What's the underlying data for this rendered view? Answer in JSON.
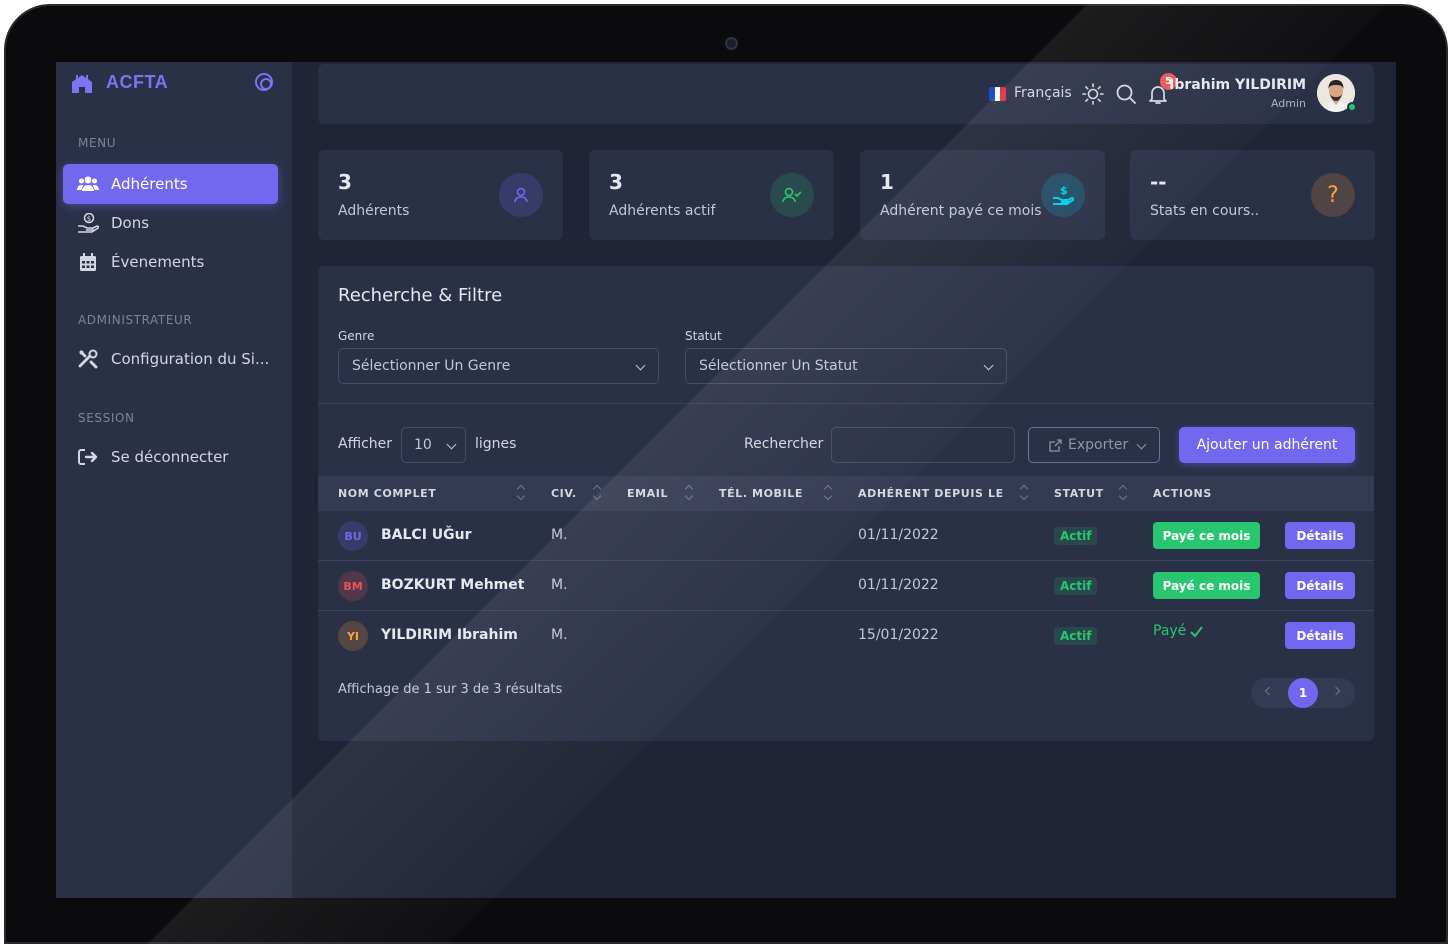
{
  "brand": {
    "name": "ACFTA"
  },
  "sidebar": {
    "sections": [
      {
        "label": "MENU"
      },
      {
        "label": "ADMINISTRATEUR"
      },
      {
        "label": "SESSION"
      }
    ],
    "items": [
      {
        "label": "Adhérents",
        "icon": "users-icon",
        "active": true
      },
      {
        "label": "Dons",
        "icon": "donation-icon"
      },
      {
        "label": "Évenements",
        "icon": "calendar-icon"
      },
      {
        "label": "Configuration du Si...",
        "icon": "tools-icon"
      },
      {
        "label": "Se déconnecter",
        "icon": "logout-icon"
      }
    ]
  },
  "topbar": {
    "language": "Français",
    "notifications_count": "5",
    "user_name": "Ibrahim YILDIRIM",
    "user_role": "Admin"
  },
  "stats": [
    {
      "value": "3",
      "label": "Adhérents",
      "icon": "user-icon",
      "color": "#7367f0"
    },
    {
      "value": "3",
      "label": "Adhérents actif",
      "icon": "user-check-icon",
      "color": "#28c76f"
    },
    {
      "value": "1",
      "label": "Adhérent payé ce mois",
      "icon": "hand-coin-icon",
      "color": "#00cfe8"
    },
    {
      "value": "--",
      "label": "Stats en cours..",
      "icon": "question-icon",
      "color": "#ff9f43"
    }
  ],
  "filter": {
    "title": "Recherche & Filtre",
    "genre_label": "Genre",
    "genre_value": "Sélectionner Un Genre",
    "statut_label": "Statut",
    "statut_value": "Sélectionner Un Statut"
  },
  "controls": {
    "show_label": "Afficher",
    "page_length": "10",
    "rows_label": "lignes",
    "search_label": "Rechercher",
    "export_label": "Exporter",
    "add_label": "Ajouter un adhérent"
  },
  "table": {
    "headers": [
      "NOM COMPLET",
      "CIV.",
      "EMAIL",
      "TÉL. MOBILE",
      "ADHÉRENT DEPUIS LE",
      "STATUT",
      "ACTIONS"
    ],
    "rows": [
      {
        "initials": "BU",
        "name": "BALCI UĞur",
        "civ": "M.",
        "email": "",
        "phone": "",
        "since": "01/11/2022",
        "status": "Actif",
        "pay": "Payé ce mois",
        "details": "Détails",
        "avatar_color": "#7367f0"
      },
      {
        "initials": "BM",
        "name": "BOZKURT Mehmet",
        "civ": "M.",
        "email": "",
        "phone": "",
        "since": "01/11/2022",
        "status": "Actif",
        "pay": "Payé ce mois",
        "details": "Détails",
        "avatar_color": "#ea5455"
      },
      {
        "initials": "YI",
        "name": "YILDIRIM Ibrahim",
        "civ": "M.",
        "email": "",
        "phone": "",
        "since": "15/01/2022",
        "status": "Actif",
        "paid": "Payé",
        "details": "Détails",
        "avatar_color": "#ff9f43"
      }
    ],
    "footer": "Affichage de 1 sur 3 de 3 résultats",
    "current_page": "1"
  }
}
